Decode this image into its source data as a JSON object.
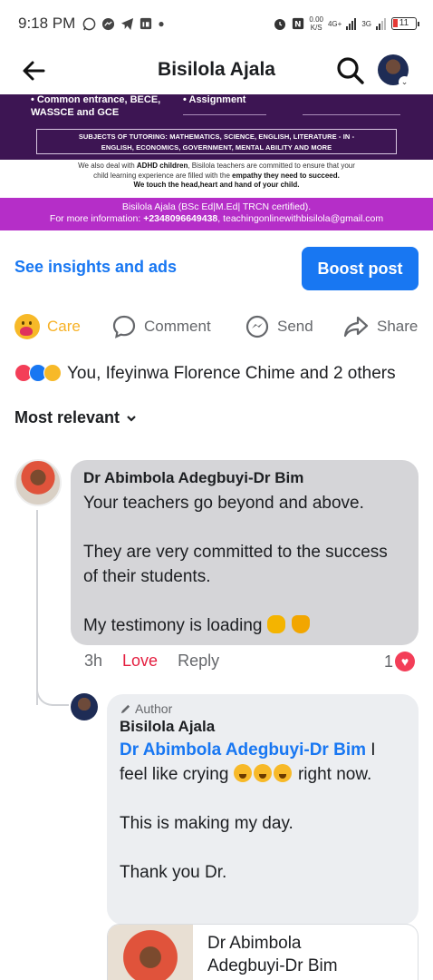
{
  "status_bar": {
    "time": "9:18 PM",
    "net_speed_value": "0.00",
    "net_speed_unit": "K/S",
    "net_type": "4G+",
    "net_type2": "3G",
    "battery": "11"
  },
  "header": {
    "title": "Bisilola Ajala"
  },
  "banner": {
    "line1": "• Common entrance, BECE,",
    "line1b": "WASSCE and GCE",
    "assignment": "• Assignment",
    "subjects_line1": "SUBJECTS OF TUTORING: MATHEMATICS, SCIENCE, ENGLISH, LITERATURE - IN -",
    "subjects_line2": "ENGLISH, ECONOMICS, GOVERNMENT, MENTAL ABILITY AND MORE",
    "body_pre": "We also deal with ",
    "body_bold1": "ADHD children",
    "body_mid": ", Bisilola teachers are committed to ensure that your",
    "body_line2_pre": "child learning experience are filled with the ",
    "body_bold2": "empathy they need to succeed.",
    "body_line3": "We touch the head,heart and hand of your child.",
    "footer_line1": "Bisilola Ajala (BSc Ed|M.Ed| TRCN certified).",
    "footer_line2_pre": "For more information: ",
    "footer_phone": "+2348096649438",
    "footer_email": ", teachingonlinewithbisilola@gmail.com"
  },
  "post_actions": {
    "insights_label": "See insights and ads",
    "boost_label": "Boost post",
    "care_label": "Care",
    "comment_label": "Comment",
    "send_label": "Send",
    "share_label": "Share"
  },
  "reactions": {
    "summary": "You, Ifeyinwa Florence Chime and 2 others"
  },
  "sort": {
    "label": "Most relevant"
  },
  "comment": {
    "author": "Dr Abimbola Adegbuyi-Dr Bim",
    "p1": "Your teachers go beyond and above.",
    "p2": "They are very committed to the success of their students.",
    "p3": "My testimony is loading",
    "time": "3h",
    "love_label": "Love",
    "reply_label": "Reply",
    "reaction_count": "1"
  },
  "reply": {
    "author_tag": "Author",
    "author": "Bisilola Ajala",
    "mention": "Dr Abimbola Adegbuyi-Dr Bim",
    "line_rest": " I feel like crying",
    "line_end": " right now.",
    "p2": "This is making my day.",
    "p3": "Thank you Dr."
  },
  "preview": {
    "name_line1": "Dr Abimbola",
    "name_line2": "Adegbuyi-Dr Bim"
  },
  "colors": {
    "accent": "#1877f2",
    "love": "#e41e3f",
    "care": "#f7b125",
    "banner_purple": "#3d1553",
    "banner_magenta": "#b52ec8"
  },
  "icons": [
    "whatsapp-icon",
    "messenger-icon",
    "telegram-icon",
    "linkedin-icon",
    "alarm-icon",
    "nfc-icon",
    "signal-icon",
    "battery-icon",
    "back-arrow-icon",
    "search-icon",
    "comment-icon",
    "send-icon",
    "share-icon",
    "pencil-icon",
    "heart-icon",
    "chevron-down-icon"
  ]
}
